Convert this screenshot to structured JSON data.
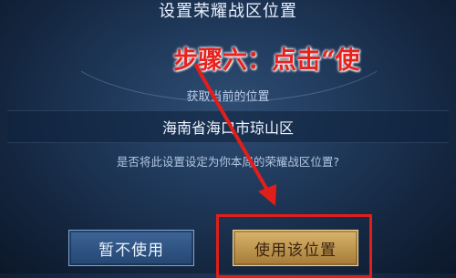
{
  "dialog": {
    "title": "设置荣耀战区位置",
    "get_location_label": "获取当前的位置",
    "location_value": "海南省海口市琼山区",
    "question": "是否将此设置设定为你本周的荣耀战区位置?",
    "cancel_label": "暂不使用",
    "confirm_label": "使用该位置"
  },
  "annotation": {
    "step_text": "步骤六：点击“使",
    "color": "#e21e1b"
  }
}
